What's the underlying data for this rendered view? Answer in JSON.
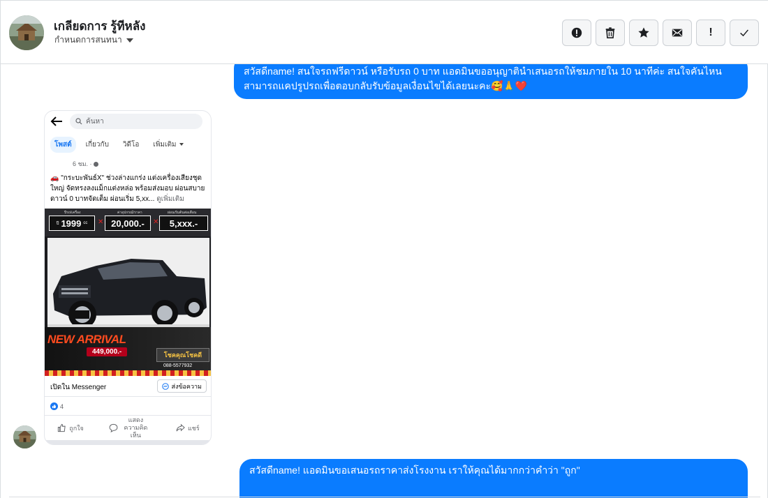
{
  "header": {
    "contact_name": "เกลียดการ รู้ทีหลัง",
    "status_label": "กำหนดการสนทนา",
    "actions": [
      {
        "name": "report-button",
        "icon": "alert-circle-icon"
      },
      {
        "name": "delete-button",
        "icon": "trash-icon"
      },
      {
        "name": "star-button",
        "icon": "star-icon"
      },
      {
        "name": "mark-unread-button",
        "icon": "envelope-icon"
      },
      {
        "name": "priority-button",
        "icon": "exclamation-icon"
      },
      {
        "name": "done-button",
        "icon": "check-icon"
      }
    ],
    "priority_glyph": "!"
  },
  "messages": {
    "outgoing_1": "สวัสดีname! สนใจรถฟรีดาวน์ หรือรับรถ 0 บาท แอดมินขออนุญาตินำเสนอรถให้ชมภายใน 10 นาทีค่ะ สนใจคันไหนสามารถแคปรูปรถเพื่อตอบกลับรับข้อมูลเงื่อนไขได้เลยนะคะ🥰🙏",
    "outgoing_1_heart": "❤️",
    "outgoing_2": "สวัสดีname! แอดมินขอเสนอรถราคาส่งโรงงาน เราให้คุณได้มากกว่าคำว่า \"ถูก\""
  },
  "post": {
    "search_placeholder": "ค้นหา",
    "tabs": [
      "โพสต์",
      "เกี่ยวกับ",
      "วิดีโอ",
      "เพิ่มเติม"
    ],
    "time": "6 ชม. · ",
    "body": "🚗 \"กระบะพันธ์X\" ช่วงล่างแกร่ง แต่งเครื่องเสียงชุดใหญ่ จัดทรงลงแม็กแต่งหล่อ พร้อมส่งมอบ ผ่อนสบาย ดาวน์ 0 บาทจัดเต็ม ผ่อนเริ่ม 5,xx...",
    "see_more": "ดูเพิ่มเติม",
    "ad": {
      "price_1": "1999",
      "price_1_prefix": "ปี",
      "price_1_unit": "cc",
      "price_2": "20,000.-",
      "price_3": "5,xxx.-",
      "mini_1": "ปีรถ/เครื่อง",
      "mini_2": "ค่าอุปกรณ์/ราคา",
      "mini_3": "ผ่อนเริ่มต้นต่อเดือน",
      "new_arrival": "NEW ARRIVAL",
      "price_tag": "449,000.-",
      "promo": "โชคคุณโชคดี",
      "phone": "088-5577932"
    },
    "open_in": "เปิดใน Messenger",
    "send_message": "ส่งข้อความ",
    "reaction_count": "4",
    "actions": {
      "like": "ถูกใจ",
      "comment": "แสดงความคิดเห็น",
      "share": "แชร์"
    }
  }
}
